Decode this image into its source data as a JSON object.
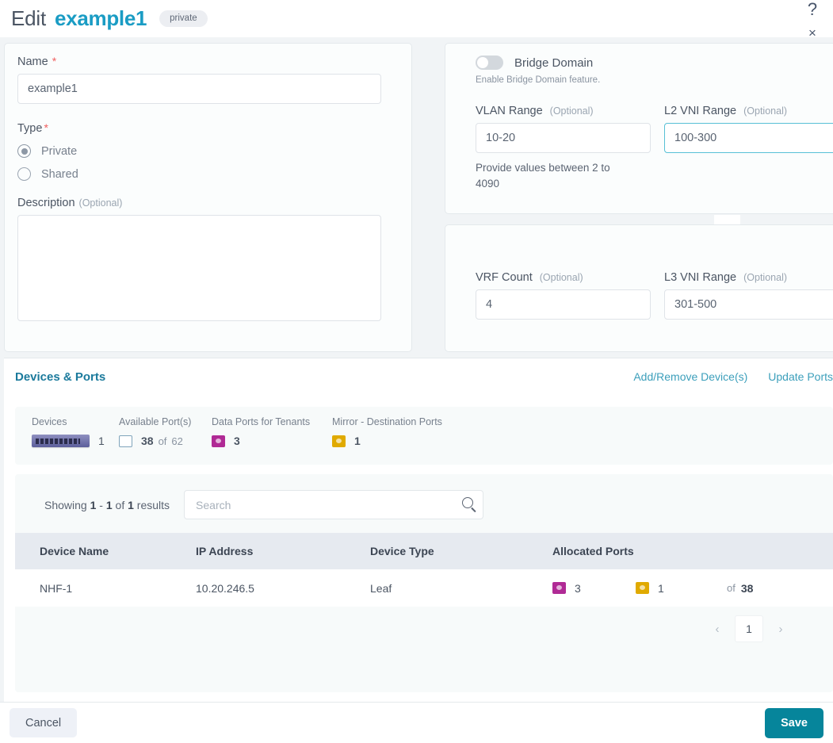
{
  "header": {
    "edit_label": "Edit",
    "entity_name": "example1",
    "badge": "private",
    "help_icon": "?",
    "close_icon": "×"
  },
  "left_form": {
    "name": {
      "label": "Name",
      "required_mark": "*",
      "value": "example1"
    },
    "type": {
      "label": "Type",
      "required_mark": "*",
      "options": [
        {
          "label": "Private",
          "selected": true
        },
        {
          "label": "Shared",
          "selected": false
        }
      ]
    },
    "description": {
      "label": "Description",
      "optional": "(Optional)",
      "value": ""
    }
  },
  "bridge_domain": {
    "toggle_label": "Bridge Domain",
    "toggle_hint": "Enable Bridge Domain feature.",
    "toggle_on": false,
    "vlan_range": {
      "label": "VLAN Range",
      "optional": "(Optional)",
      "value": "10-20",
      "hint": "Provide values between 2 to 4090"
    },
    "l2_vni_range": {
      "label": "L2 VNI Range",
      "optional": "(Optional)",
      "value": "100-300",
      "focused": true
    }
  },
  "vrf_section": {
    "vrf_count": {
      "label": "VRF Count",
      "optional": "(Optional)",
      "value": "4"
    },
    "l3_vni_range": {
      "label": "L3 VNI Range",
      "optional": "(Optional)",
      "value": "301-500"
    }
  },
  "devices_ports": {
    "title": "Devices & Ports",
    "actions": [
      {
        "label": "Add/Remove Device(s)"
      },
      {
        "label": "Update Ports"
      }
    ],
    "stats": {
      "labels": {
        "devices": "Devices",
        "available": "Available Port(s)",
        "data_ports": "Data Ports for Tenants",
        "mirror_ports": "Mirror - Destination Ports"
      },
      "devices_count": "1",
      "available_count": "38",
      "available_of": "of",
      "available_total": "62",
      "data_ports_count": "3",
      "mirror_ports_count": "1"
    },
    "results": {
      "showing_prefix": "Showing",
      "showing_from": "1",
      "showing_dash": "-",
      "showing_to": "1",
      "showing_of": "of",
      "showing_total": "1",
      "showing_suffix": "results",
      "search_placeholder": "Search",
      "search_value": ""
    },
    "table": {
      "columns": [
        "Device Name",
        "IP Address",
        "Device Type",
        "Allocated Ports"
      ],
      "rows": [
        {
          "device_name": "NHF-1",
          "ip_address": "10.20.246.5",
          "device_type": "Leaf",
          "data_ports": "3",
          "mirror_ports": "1",
          "of_label": "of",
          "total_ports": "38"
        }
      ]
    },
    "pagination": {
      "prev_icon": "‹",
      "current_page": "1",
      "next_icon": "›"
    }
  },
  "footer": {
    "cancel_label": "Cancel",
    "save_label": "Save"
  },
  "colors": {
    "accent_teal": "#1a9cc4",
    "save_button": "#06859b",
    "link": "#3c9fbb",
    "required_star": "#f05f5f",
    "data_port_icon": "#b02a95",
    "mirror_port_icon": "#e0aa00",
    "focus_border": "#57c0d6"
  }
}
